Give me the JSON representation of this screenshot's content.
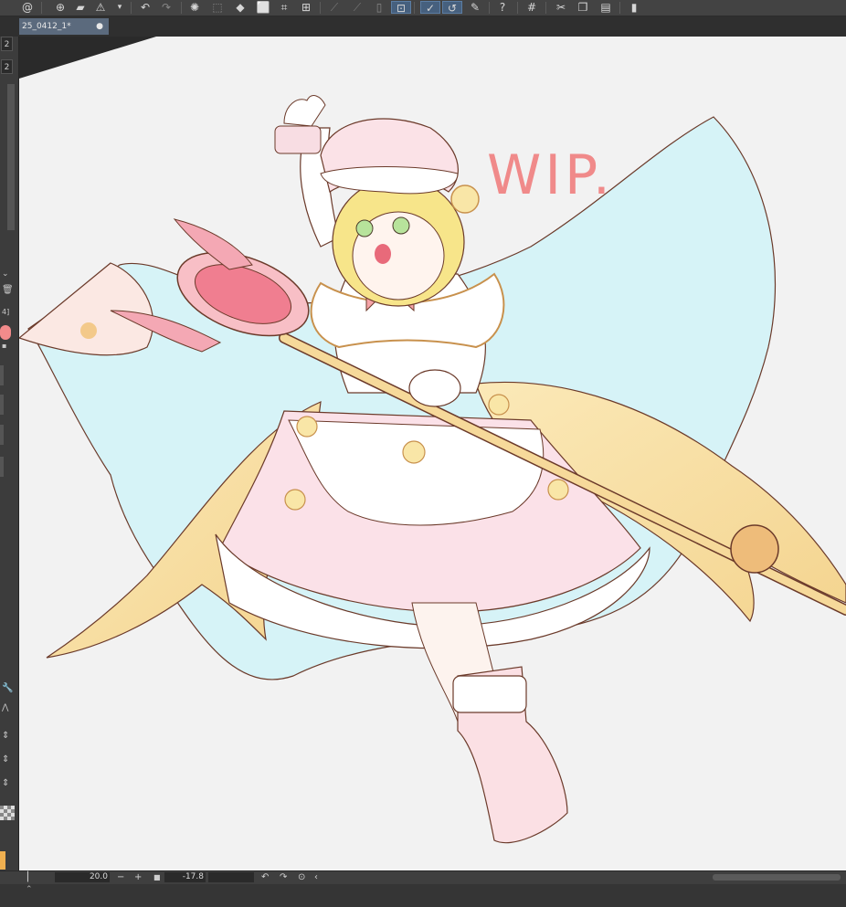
{
  "document": {
    "tab_title": "25_0412_1*",
    "tab_modified_marker": "●"
  },
  "left_panel": {
    "value_top": "2",
    "value_second": "2",
    "layer_label": "4]"
  },
  "status": {
    "zoom": "20.0",
    "rotation": "-17.8",
    "zoom_out": "−",
    "zoom_in": "+"
  },
  "canvas": {
    "wip_text": "WIP.",
    "background_color": "#f2f2f2",
    "wip_color": "#f08a8a"
  },
  "toolbar_icons": [
    "spiral-icon",
    "new-icon",
    "open-icon",
    "warning-icon",
    "dropdown-icon",
    "undo-icon",
    "redo-icon",
    "loading-icon",
    "select-icon",
    "fill-icon",
    "transform-icon",
    "crop-icon",
    "mesh-icon",
    "ruler-icon",
    "layer-icon",
    "snap-icon",
    "pen-snap-icon",
    "curve-snap-icon",
    "edit-icon",
    "help-icon",
    "grid-icon",
    "cut-icon",
    "copy-icon",
    "paste-icon",
    "phone-icon"
  ]
}
